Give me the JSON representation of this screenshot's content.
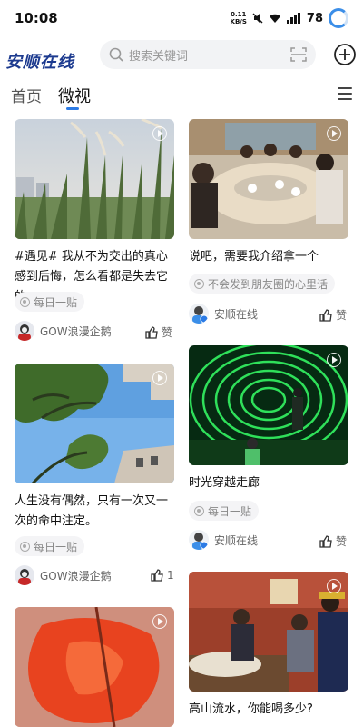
{
  "status": {
    "time": "10:08",
    "speed_top": "0.11",
    "speed_bottom": "KB/S",
    "battery": "78"
  },
  "header": {
    "logo_text": "安顺在线",
    "search_placeholder": "搜索关键词"
  },
  "tabs": [
    {
      "label": "首页"
    },
    {
      "label": "微视"
    }
  ],
  "colors": {
    "accent": "#2c7be5",
    "logo": "#1c3a8f"
  },
  "feed": {
    "left": [
      {
        "title": "#遇见# 我从不为交出的真心感到后悔，怎么看都是失去它的...",
        "tag": "每日一贴",
        "author": "GOW浪漫企鹅",
        "like": "赞"
      },
      {
        "title": "人生没有偶然，只有一次又一次的命中注定。",
        "tag": "每日一贴",
        "author": "GOW浪漫企鹅",
        "like": "1"
      },
      {
        "title": "",
        "tag": "",
        "author": "",
        "like": ""
      }
    ],
    "right": [
      {
        "title": "说吧，需要我介绍拿一个",
        "tag": "不会发到朋友圈的心里话",
        "author": "安顺在线",
        "like": "赞"
      },
      {
        "title": "时光穿越走廊",
        "tag": "每日一贴",
        "author": "安顺在线",
        "like": "赞"
      },
      {
        "title": "高山流水，你能喝多少?",
        "tag": "",
        "author": "",
        "like": ""
      }
    ]
  },
  "icons": [
    "search-icon",
    "scan-icon",
    "plus-icon",
    "menu-icon",
    "play-icon",
    "thumbs-up-icon",
    "wifi-icon",
    "signal-icon",
    "battery-ring-icon"
  ]
}
